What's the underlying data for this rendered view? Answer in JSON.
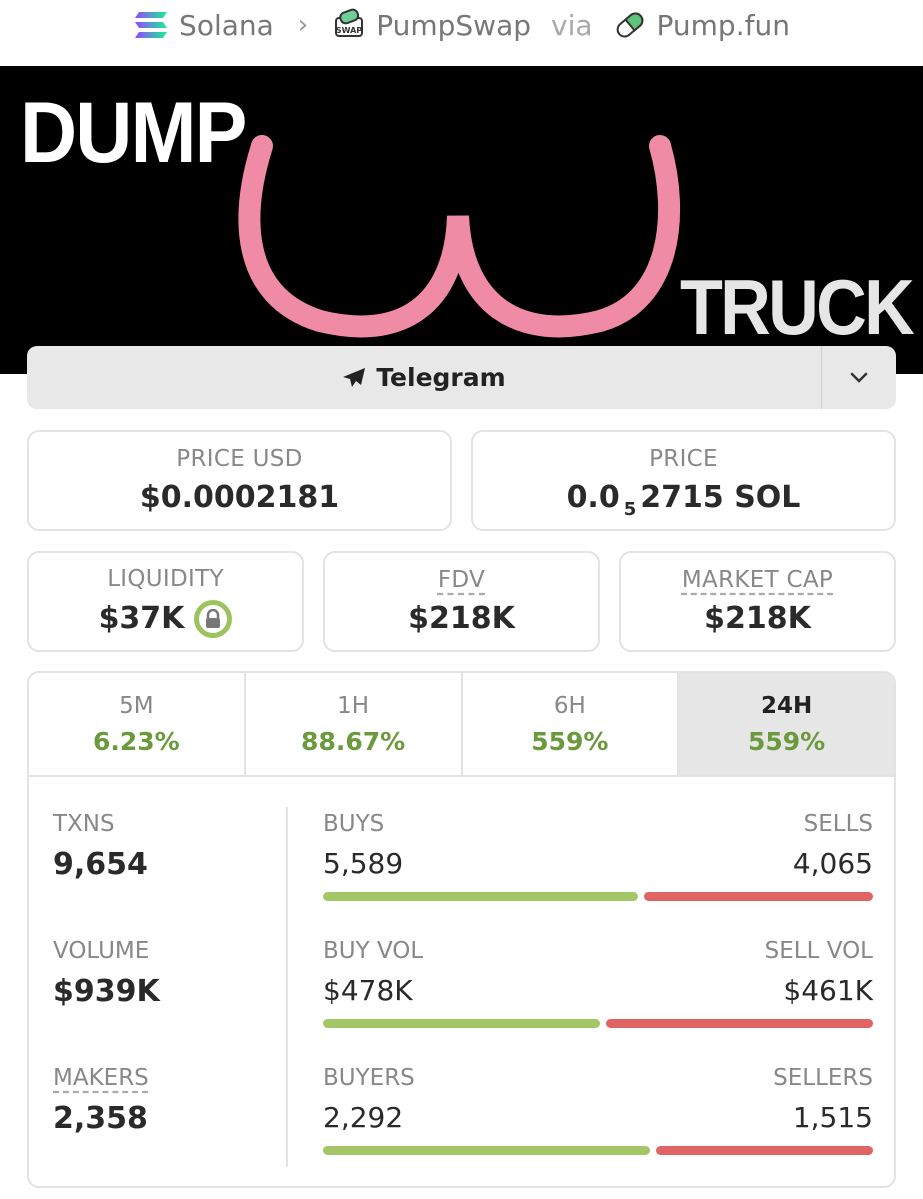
{
  "breadcrumb": {
    "chain": "Solana",
    "dex": "PumpSwap",
    "via": "via",
    "launchpad": "Pump.fun",
    "swap_badge": "SWAP"
  },
  "banner": {
    "top_text": "DUMP",
    "bottom_text": "TRUCK"
  },
  "links": {
    "telegram_label": "Telegram"
  },
  "stats": {
    "price_usd_label": "PRICE USD",
    "price_usd": "$0.0002181",
    "price_label": "PRICE",
    "price_prefix": "0.0",
    "price_zeros": "5",
    "price_rest": "2715 SOL",
    "liquidity_label": "LIQUIDITY",
    "liquidity": "$37K",
    "fdv_label": "FDV",
    "fdv": "$218K",
    "mcap_label": "MARKET CAP",
    "mcap": "$218K"
  },
  "timeframes": [
    {
      "label": "5M",
      "change": "6.23%"
    },
    {
      "label": "1H",
      "change": "88.67%"
    },
    {
      "label": "6H",
      "change": "559%"
    },
    {
      "label": "24H",
      "change": "559%",
      "active": true
    }
  ],
  "txns": {
    "txns_label": "TXNS",
    "txns": "9,654",
    "volume_label": "VOLUME",
    "volume": "$939K",
    "makers_label": "MAKERS",
    "makers": "2,358",
    "buys_label": "BUYS",
    "buys": "5,589",
    "sells_label": "SELLS",
    "sells": "4,065",
    "buy_vol_label": "BUY VOL",
    "buy_vol": "$478K",
    "sell_vol_label": "SELL VOL",
    "sell_vol": "$461K",
    "buyers_label": "BUYERS",
    "buyers": "2,292",
    "sellers_label": "SELLERS",
    "sellers": "1,515",
    "buy_ratio": 0.579,
    "buy_vol_ratio": 0.509,
    "buyers_ratio": 0.602
  },
  "colors": {
    "positive": "#6b9a3c",
    "buy_bar": "#a3c766",
    "sell_bar": "#e06464",
    "lock_ring": "#9cc35f"
  }
}
